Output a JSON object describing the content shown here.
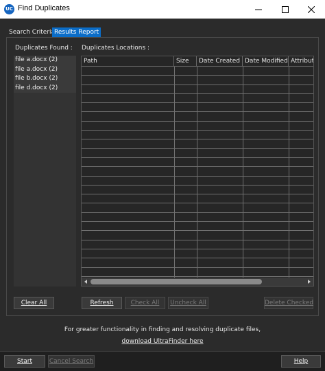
{
  "window": {
    "title": "Find Duplicates",
    "app_icon_text": "UC",
    "icons": [
      "minimize-icon",
      "maximize-icon",
      "close-icon"
    ]
  },
  "tabs": [
    {
      "label": "Search Criteria",
      "active": false
    },
    {
      "label": "Results Report",
      "active": true
    }
  ],
  "found": {
    "label": "Duplicates Found :",
    "items": [
      "file a.docx (2)",
      "file a.docx (2)",
      "file b.docx (2)",
      "file d.docx (2)"
    ]
  },
  "locations": {
    "label": "Duplicates Locations :",
    "columns": [
      "Path",
      "Size",
      "Date Created",
      "Date Modified",
      "Attribute"
    ]
  },
  "buttons": {
    "clear_all": "Clear All",
    "refresh": "Refresh",
    "check_all": "Check All",
    "uncheck_all": "Uncheck All",
    "delete_checked": "Delete Checked",
    "start": "Start",
    "cancel_search": "Cancel Search",
    "help": "Help"
  },
  "footer": {
    "text": "For greater functionality in finding and resolving duplicate files,",
    "link": "download UltraFinder here"
  },
  "colors": {
    "background": "#2b2b2b",
    "accent": "#0b6dc8"
  }
}
